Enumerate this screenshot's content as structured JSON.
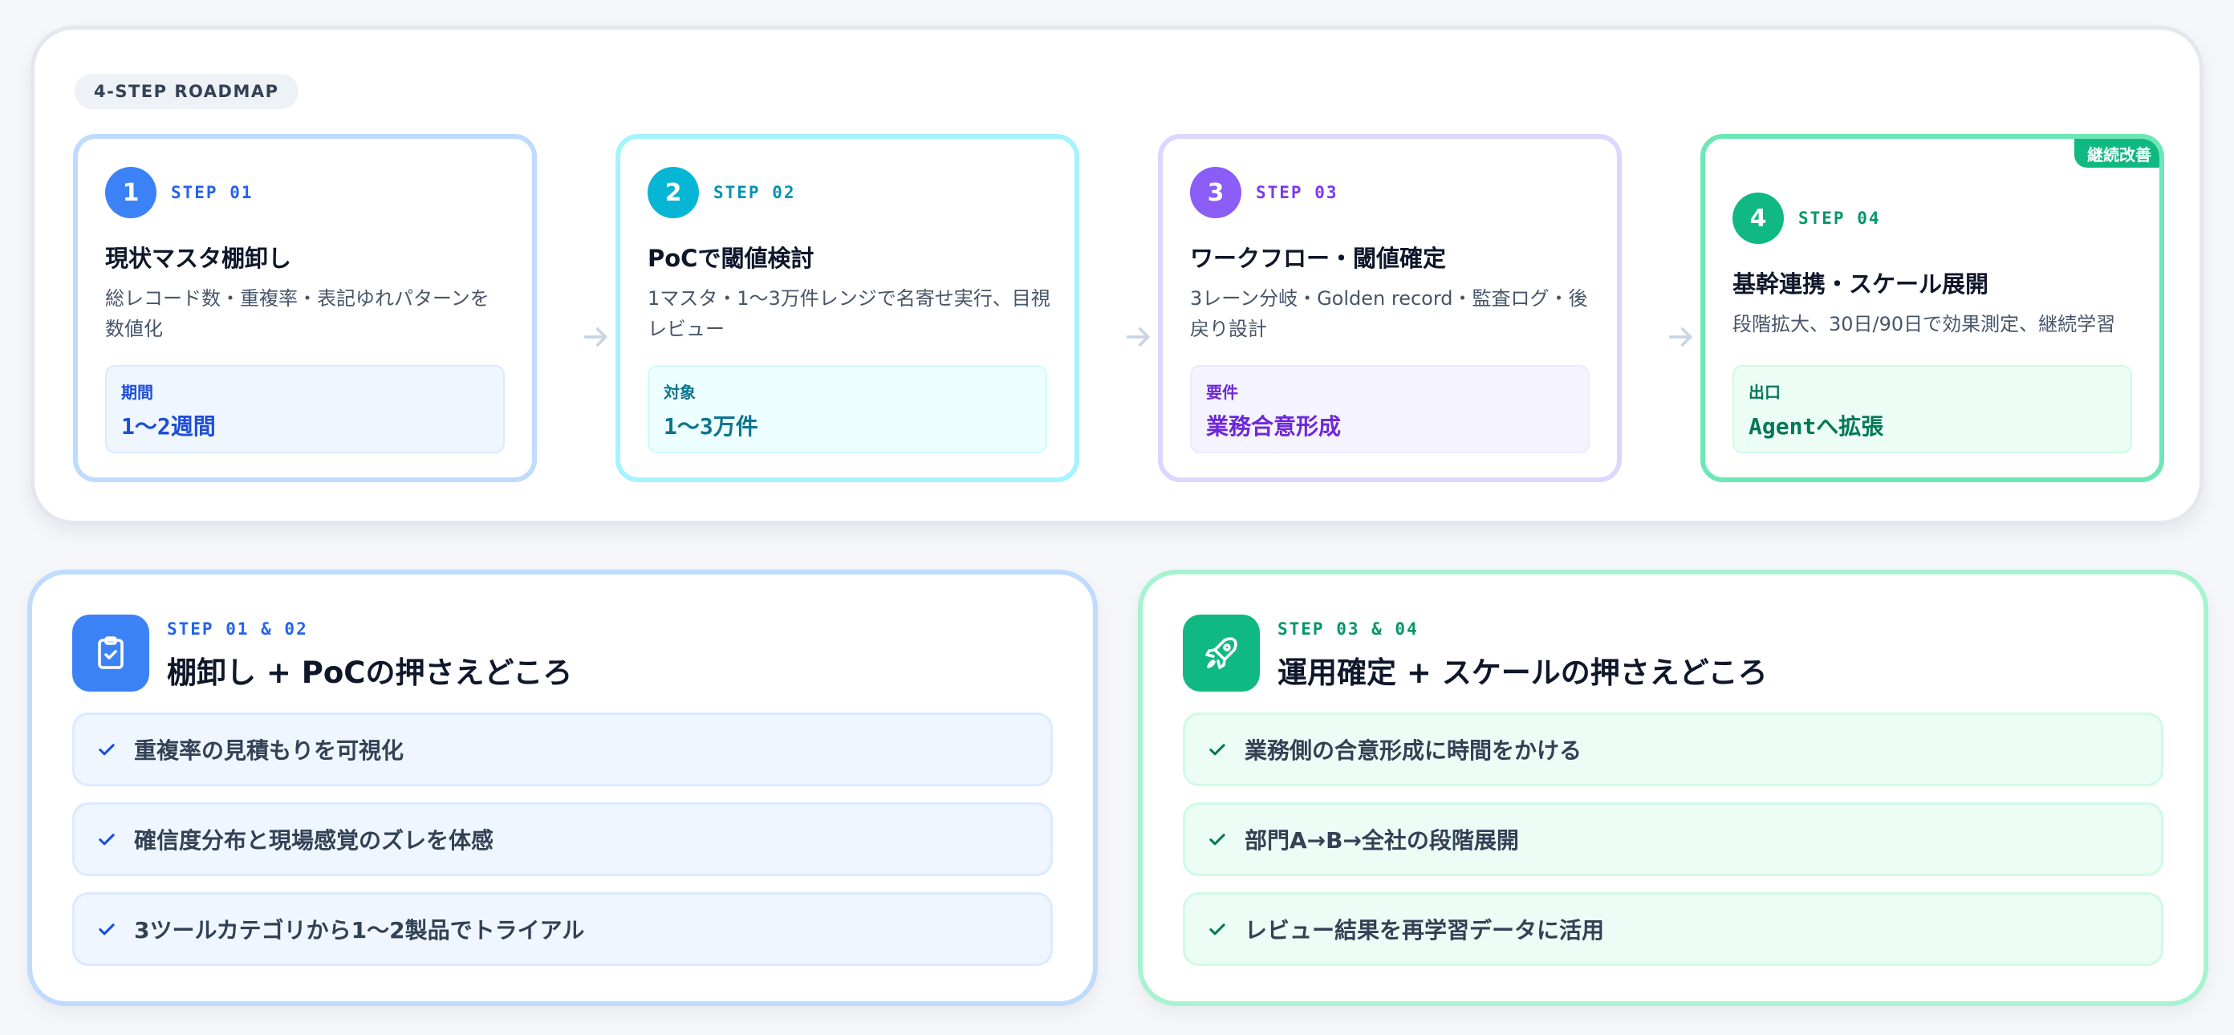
{
  "roadmap": {
    "label": "4-STEP ROADMAP",
    "steps": [
      {
        "number": "1",
        "code": "STEP 01",
        "title": "現状マスタ棚卸し",
        "description": "総レコード数・重複率・表記ゆれパターンを数値化",
        "meta_label": "期間",
        "meta_value": "1〜2週間",
        "color": "#3b82f6"
      },
      {
        "number": "2",
        "code": "STEP 02",
        "title": "PoCで閾値検討",
        "description": "1マスタ・1〜3万件レンジで名寄せ実行、目視レビュー",
        "meta_label": "対象",
        "meta_value": "1〜3万件",
        "color": "#06b6d4"
      },
      {
        "number": "3",
        "code": "STEP 03",
        "title": "ワークフロー・閾値確定",
        "description": "3レーン分岐・Golden record・監査ログ・後戻り設計",
        "meta_label": "要件",
        "meta_value": "業務合意形成",
        "color": "#8b5cf6"
      },
      {
        "number": "4",
        "code": "STEP 04",
        "title": "基幹連携・スケール展開",
        "description": "段階拡大、30日/90日で効果測定、継続学習",
        "meta_label": "出口",
        "meta_value": "Agentへ拡張",
        "badge": "継続改善",
        "color": "#10b981"
      }
    ]
  },
  "panels": {
    "left": {
      "code": "STEP 01 & 02",
      "title": "棚卸し + PoCの押さえどころ",
      "icon": "clipboard-check-icon",
      "items": [
        "重複率の見積もりを可視化",
        "確信度分布と現場感覚のズレを体感",
        "3ツールカテゴリから1〜2製品でトライアル"
      ]
    },
    "right": {
      "code": "STEP 03 & 04",
      "title": "運用確定 + スケールの押さえどころ",
      "icon": "rocket-icon",
      "items": [
        "業務側の合意形成に時間をかける",
        "部門A→B→全社の段階展開",
        "レビュー結果を再学習データに活用"
      ]
    }
  }
}
